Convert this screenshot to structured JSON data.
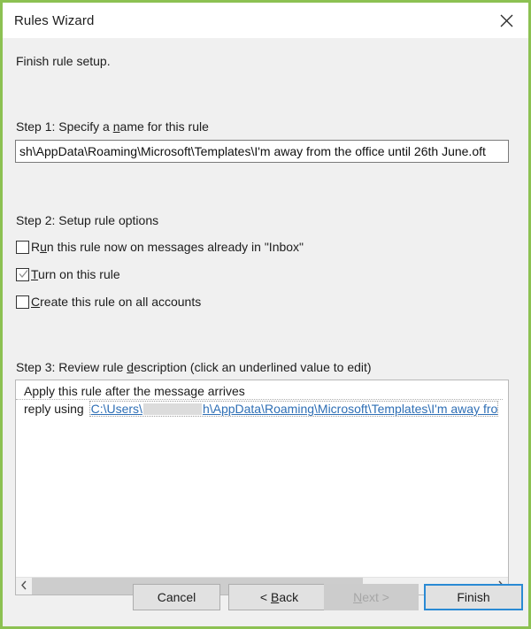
{
  "window": {
    "title": "Rules Wizard",
    "close_icon": "close-icon",
    "border_color": "#8cc152"
  },
  "content": {
    "subtitle": "Finish rule setup.",
    "step1": {
      "label_prefix": "Step 1: Specify a ",
      "label_accel": "n",
      "label_suffix": "ame for this rule",
      "input_value": "sh\\AppData\\Roaming\\Microsoft\\Templates\\I'm away from the office until 26th June.oft",
      "input_placeholder": ""
    },
    "step2": {
      "label": "Step 2: Setup rule options",
      "options": [
        {
          "accel": "R",
          "prefix": "R",
          "accel_letter": "u",
          "suffix": "n this rule now on messages already in \"Inbox\"",
          "checked": false
        },
        {
          "prefix": "",
          "accel_letter": "T",
          "suffix": "urn on this rule",
          "checked": true
        },
        {
          "prefix": "",
          "accel_letter": "C",
          "suffix": "reate this rule on all accounts",
          "checked": false
        }
      ]
    },
    "step3": {
      "label_prefix": "Step 3: Review rule ",
      "label_accel": "d",
      "label_suffix": "escription (click an underlined value to edit)",
      "description_line1": "Apply this rule after the message arrives",
      "description_line2_prefix": "reply using ",
      "description_link_before": "C:\\Users\\",
      "description_link_redacted": true,
      "description_link_after": "h\\AppData\\Roaming\\Microsoft\\Templates\\I'm away fro",
      "link_color": "#2f6fb5",
      "scrollbar": {
        "left_arrow": "chevron-left-icon",
        "right_arrow": "chevron-right-icon",
        "thumb_extent_percent": 72
      }
    }
  },
  "footer": {
    "cancel": "Cancel",
    "back_prefix": "< ",
    "back_accel": "B",
    "back_suffix": "ack",
    "next_accel": "N",
    "next_suffix": "ext >",
    "next_disabled": true,
    "finish": "Finish",
    "finish_focus_color": "#2a8ad4"
  }
}
